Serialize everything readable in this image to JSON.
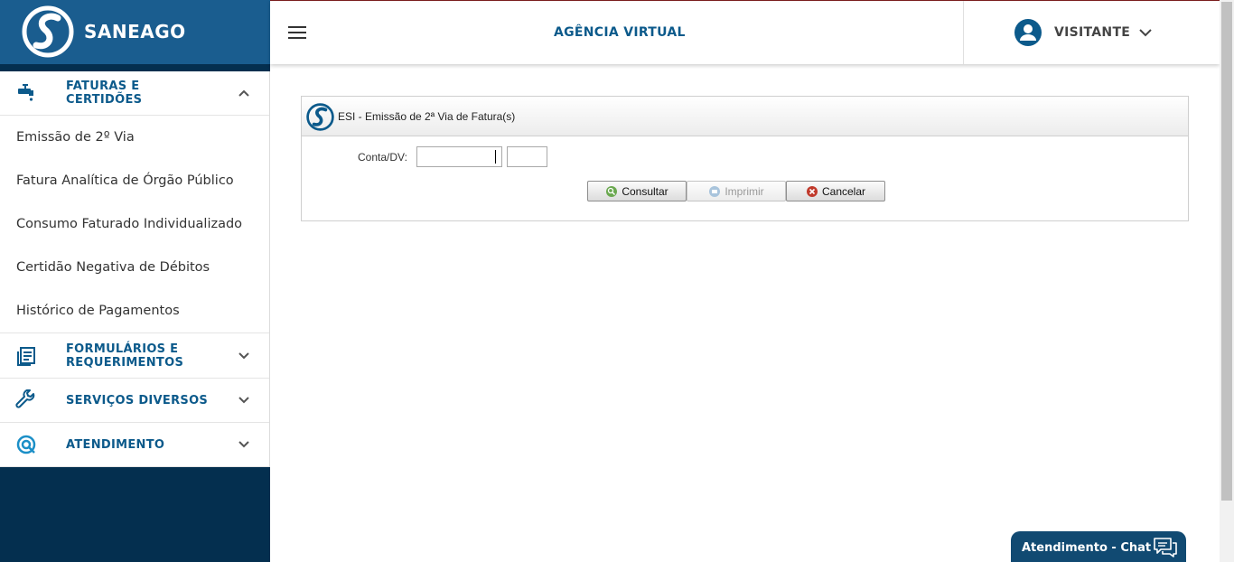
{
  "brand": {
    "name": "SANEAGO"
  },
  "header": {
    "title": "AGÊNCIA VIRTUAL",
    "user_name": "VISITANTE"
  },
  "sidebar": {
    "sections": [
      {
        "label": "FATURAS E CERTIDÕES",
        "icon": "faucet-icon",
        "expanded": true,
        "items": [
          {
            "label": "Emissão de 2º Via"
          },
          {
            "label": "Fatura Analítica de Órgão Público"
          },
          {
            "label": "Consumo Faturado Individualizado"
          },
          {
            "label": "Certidão Negativa de Débitos"
          },
          {
            "label": "Histórico de Pagamentos"
          }
        ]
      },
      {
        "label": "FORMULÁRIOS E REQUERIMENTOS",
        "icon": "documents-icon",
        "expanded": false
      },
      {
        "label": "SERVIÇOS DIVERSOS",
        "icon": "wrench-icon",
        "expanded": false
      },
      {
        "label": "ATENDIMENTO",
        "icon": "at-sign-icon",
        "expanded": false
      }
    ]
  },
  "panel": {
    "title": "ESI - Emissão de 2ª Via de Fatura(s)",
    "account_label": "Conta/DV:",
    "account_value": "",
    "dv_value": "",
    "buttons": {
      "consult": "Consultar",
      "print": "Imprimir",
      "cancel": "Cancelar"
    }
  },
  "chat": {
    "label": "Atendimento - Chat"
  },
  "colors": {
    "brand_blue": "#1a5d8f",
    "navy": "#042f4f",
    "link_blue": "#0c5a8b"
  }
}
